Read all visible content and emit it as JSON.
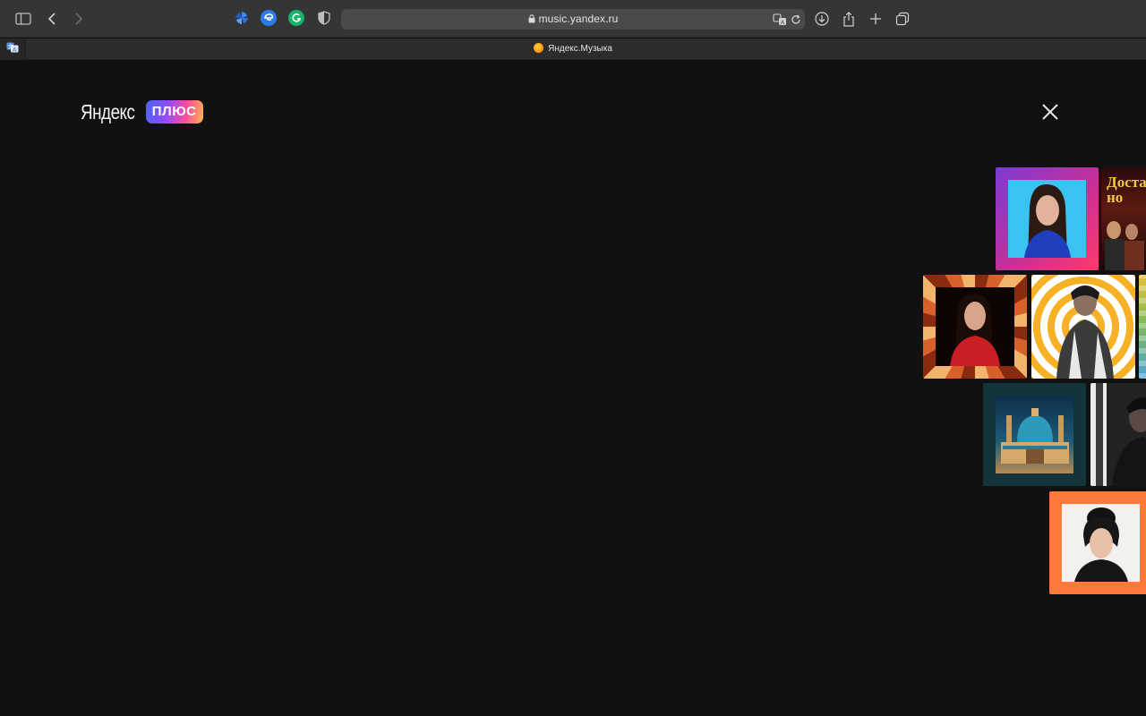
{
  "browser": {
    "url": "music.yandex.ru",
    "tab_title": "Яндекс.Музыка"
  },
  "page": {
    "logo_text": "Яндекс",
    "logo_badge": "ПЛЮС",
    "poster_text": "Доста но"
  },
  "colors": {
    "background": "#111111",
    "badge_gradient": [
      "#4d64ff",
      "#8a4dff",
      "#ff4d9a",
      "#ffb84d"
    ]
  }
}
